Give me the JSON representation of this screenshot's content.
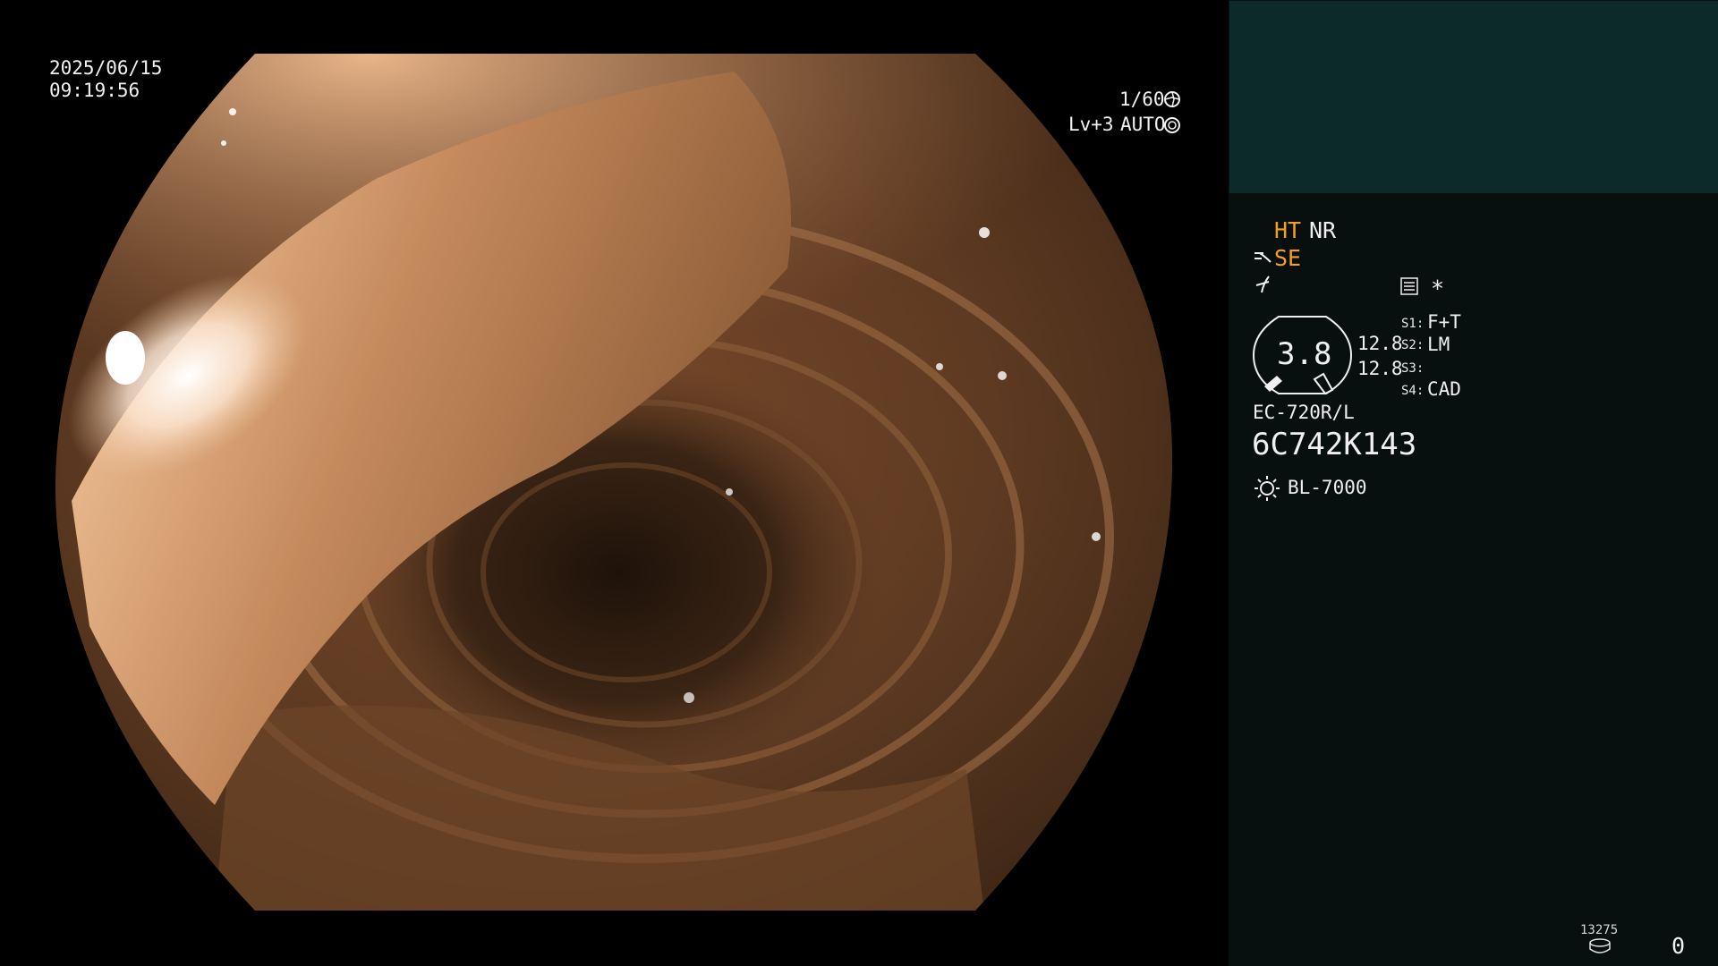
{
  "overlay": {
    "date": "2025/06/15",
    "time": "09:19:56",
    "shutter": "1/60",
    "shutter_icon": "aperture-icon",
    "level": "Lv+3",
    "iris_mode": "AUTO",
    "iris_icon": "iris-icon"
  },
  "panel": {
    "ht": "HT",
    "nr": "NR",
    "se": "SE",
    "settings_icon": "menu-list-icon",
    "asterisk": "*",
    "zoom_value": "3.8",
    "dist_1": "12.8",
    "dist_2": "12.8",
    "s1_label": "S1:",
    "s1_value": "F+T",
    "s2_label": "S2:",
    "s2_value": "LM",
    "s3_label": "S3:",
    "s3_value": "",
    "s4_label": "S4:",
    "s4_value": "CAD",
    "scope_model": "EC-720R/L",
    "serial": "6C742K143",
    "light_source": "BL-7000",
    "light_icon": "sun-icon",
    "counter_small": "13275",
    "counter": "0",
    "colors": {
      "accent": "#f3a021",
      "panel_bg": "#08100f",
      "panel_top_bg": "#0b2a29"
    }
  }
}
